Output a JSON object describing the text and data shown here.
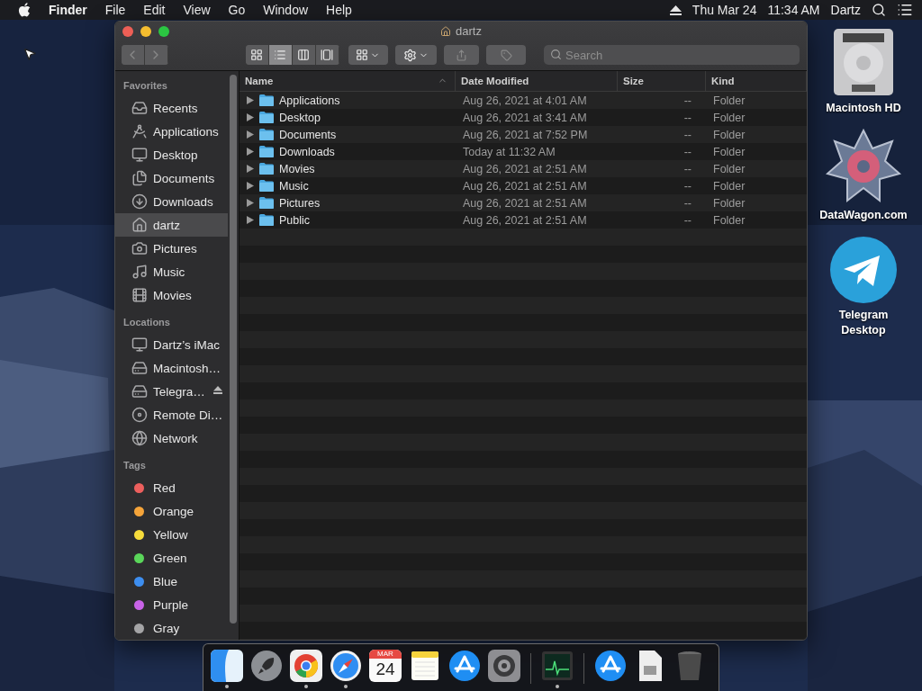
{
  "menubar": {
    "app_name": "Finder",
    "menus": [
      "File",
      "Edit",
      "View",
      "Go",
      "Window",
      "Help"
    ],
    "date": "Thu Mar 24",
    "time": "11:34 AM",
    "user": "Dartz"
  },
  "window": {
    "title": "dartz",
    "toolbar": {
      "view_buttons": [
        {
          "kind": "icons",
          "selected": false
        },
        {
          "kind": "list",
          "selected": true
        },
        {
          "kind": "columns",
          "selected": false
        },
        {
          "kind": "gallery",
          "selected": false
        }
      ],
      "search": {
        "placeholder": "Search"
      }
    },
    "sidebar": {
      "sections": [
        {
          "heading": "Favorites",
          "items": [
            {
              "kind": "place",
              "label": "Recents",
              "selected": false
            },
            {
              "kind": "place",
              "label": "Applications",
              "selected": false
            },
            {
              "kind": "place",
              "label": "Desktop",
              "selected": false
            },
            {
              "kind": "place",
              "label": "Documents",
              "selected": false
            },
            {
              "kind": "place",
              "label": "Downloads",
              "selected": false
            },
            {
              "kind": "place",
              "label": "dartz",
              "selected": true
            },
            {
              "kind": "place",
              "label": "Pictures",
              "selected": false
            },
            {
              "kind": "place",
              "label": "Music",
              "selected": false
            },
            {
              "kind": "place",
              "label": "Movies",
              "selected": false
            }
          ]
        },
        {
          "heading": "Locations",
          "items": [
            {
              "kind": "place",
              "label": "Dartz’s iMac",
              "selected": false
            },
            {
              "kind": "place",
              "label": "Macintosh…",
              "selected": false
            },
            {
              "kind": "place",
              "label": "Telegra…",
              "selected": false,
              "ejectable": true
            },
            {
              "kind": "place",
              "label": "Remote Di…",
              "selected": false
            },
            {
              "kind": "place",
              "label": "Network",
              "selected": false
            }
          ]
        },
        {
          "heading": "Tags",
          "items": [
            {
              "kind": "tag",
              "label": "Red",
              "color": "#ec5f5d",
              "selected": false
            },
            {
              "kind": "tag",
              "label": "Orange",
              "color": "#f5a43a",
              "selected": false
            },
            {
              "kind": "tag",
              "label": "Yellow",
              "color": "#f7dc3b",
              "selected": false
            },
            {
              "kind": "tag",
              "label": "Green",
              "color": "#5ad65a",
              "selected": false
            },
            {
              "kind": "tag",
              "label": "Blue",
              "color": "#3d8ef0",
              "selected": false
            },
            {
              "kind": "tag",
              "label": "Purple",
              "color": "#c963e8",
              "selected": false
            },
            {
              "kind": "tag",
              "label": "Gray",
              "color": "#a4a4a6",
              "selected": false
            }
          ]
        }
      ]
    },
    "table": {
      "columns": [
        {
          "label": "Name",
          "sorted": true
        },
        {
          "label": "Date Modified",
          "sorted": false
        },
        {
          "label": "Size",
          "sorted": false
        },
        {
          "label": "Kind",
          "sorted": false
        }
      ],
      "rows": [
        {
          "name": "Applications",
          "date": "Aug 26, 2021 at 4:01 AM",
          "size": "--",
          "kind": "Folder",
          "expanded": false
        },
        {
          "name": "Desktop",
          "date": "Aug 26, 2021 at 3:41 AM",
          "size": "--",
          "kind": "Folder",
          "expanded": false
        },
        {
          "name": "Documents",
          "date": "Aug 26, 2021 at 7:52 PM",
          "size": "--",
          "kind": "Folder",
          "expanded": false
        },
        {
          "name": "Downloads",
          "date": "Today at 11:32 AM",
          "size": "--",
          "kind": "Folder",
          "expanded": false
        },
        {
          "name": "Movies",
          "date": "Aug 26, 2021 at 2:51 AM",
          "size": "--",
          "kind": "Folder",
          "expanded": false
        },
        {
          "name": "Music",
          "date": "Aug 26, 2021 at 2:51 AM",
          "size": "--",
          "kind": "Folder",
          "expanded": false
        },
        {
          "name": "Pictures",
          "date": "Aug 26, 2021 at 2:51 AM",
          "size": "--",
          "kind": "Folder",
          "expanded": false
        },
        {
          "name": "Public",
          "date": "Aug 26, 2021 at 2:51 AM",
          "size": "--",
          "kind": "Folder",
          "expanded": false
        }
      ]
    }
  },
  "desktop_icons": [
    {
      "kind": "disk",
      "label": "Macintosh HD"
    },
    {
      "kind": "web",
      "label": "DataWagon.com"
    },
    {
      "kind": "telegram",
      "label": "Telegram Desktop"
    }
  ],
  "dock": {
    "items": [
      {
        "kind": "finder",
        "running": true
      },
      {
        "kind": "launchpad",
        "running": false
      },
      {
        "kind": "chrome",
        "running": true
      },
      {
        "kind": "safari",
        "running": true
      },
      {
        "kind": "calendar",
        "running": false,
        "month": "MAR",
        "day": "24"
      },
      {
        "kind": "notes",
        "running": false
      },
      {
        "kind": "appstore",
        "running": false
      },
      {
        "kind": "preferences",
        "running": false
      },
      {
        "kind": "separator"
      },
      {
        "kind": "activity",
        "running": true
      },
      {
        "kind": "separator"
      },
      {
        "kind": "appstore",
        "running": false
      },
      {
        "kind": "file",
        "running": false
      },
      {
        "kind": "trash",
        "running": false
      }
    ]
  }
}
